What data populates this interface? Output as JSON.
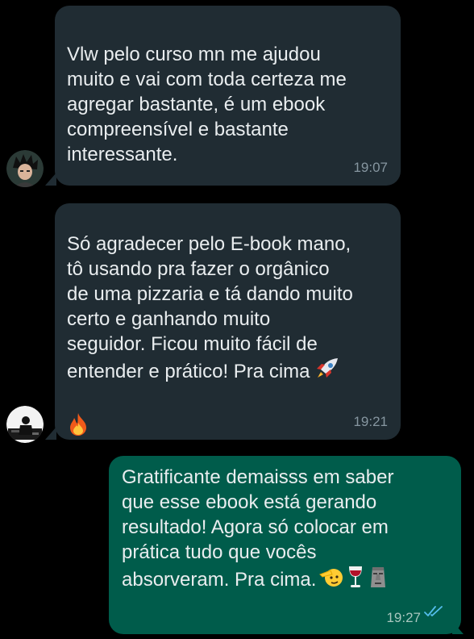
{
  "messages": [
    {
      "direction": "incoming",
      "text": "Vlw pelo curso mn me ajudou\nmuito e vai com toda certeza me\nagregar bastante, é um ebook\ncompreensível e bastante\ninteressante.",
      "time": "19:07",
      "avatar": "anime-character-avatar"
    },
    {
      "direction": "incoming",
      "text": "Só agradecer pelo E-book mano,\ntô usando pra fazer o orgânico\nde uma pizzaria e tá dando muito\ncerto e ganhando muito\nseguidor. Ficou muito fácil de\nentender e prático! Pra cima",
      "emojis": [
        "rocket",
        "fire"
      ],
      "time": "19:21",
      "avatar": "person-silhouette-avatar"
    },
    {
      "direction": "outgoing",
      "text": "Gratificante demaisss em saber\nque esse ebook está gerando\nresultado! Agora só colocar em\nprática tudo que vocês\nabsorveram. Pra cima.",
      "emojis": [
        "saluting-face",
        "wine-glass",
        "moai"
      ],
      "time": "19:27",
      "status": "read-double-check"
    }
  ],
  "colors": {
    "background": "#000000",
    "incoming_bubble": "#202c33",
    "outgoing_bubble": "#005c4b",
    "text": "#e9edef",
    "timestamp": "#8696a0",
    "read_ticks": "#53bdeb"
  }
}
